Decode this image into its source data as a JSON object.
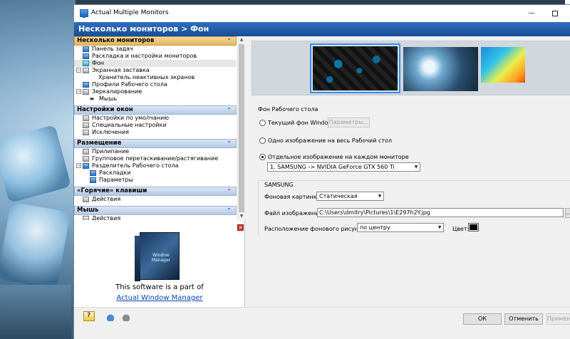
{
  "window": {
    "title": "Actual Multiple Monitors",
    "min_glyph": "—",
    "header": "Несколько мониторов > Фон"
  },
  "nav": {
    "sections": [
      {
        "title": "Несколько мониторов",
        "items": [
          {
            "label": "Панель задач",
            "icon": "taskbar-icon"
          },
          {
            "label": "Раскладка и настройки мониторов",
            "icon": "monitor-layout-icon"
          },
          {
            "label": "Фон",
            "icon": "wallpaper-icon",
            "selected": true
          },
          {
            "label": "Экранная заставка",
            "icon": "screensaver-icon",
            "expander": "−"
          },
          {
            "label": "Хранитель неактивных экранов",
            "icon": "",
            "indent": true
          },
          {
            "label": "Профили Рабочего стола",
            "icon": "desktop-profiles-icon"
          },
          {
            "label": "Зеркалирование",
            "icon": "mirroring-icon",
            "expander": "−"
          },
          {
            "label": "Мышь",
            "icon": "mouse-icon",
            "indent": true
          }
        ]
      },
      {
        "title": "Настройки окон",
        "items": [
          {
            "label": "Настройки по умолчанию",
            "icon": "window-default-icon"
          },
          {
            "label": "Специальные настройки",
            "icon": "window-special-icon"
          },
          {
            "label": "Исключения",
            "icon": "exclusions-icon"
          }
        ]
      },
      {
        "title": "Размещение",
        "items": [
          {
            "label": "Прилипание",
            "icon": "snapping-icon"
          },
          {
            "label": "Групповое перетаскивание/растягивание",
            "icon": "group-drag-icon"
          },
          {
            "label": "Разделитель Рабочего стола",
            "icon": "desktop-divider-icon",
            "expander": "−"
          },
          {
            "label": "Раскладки",
            "icon": "layouts-icon",
            "indent": true
          },
          {
            "label": "Параметры",
            "icon": "parameters-icon",
            "indent": true
          }
        ]
      },
      {
        "title": "«Горячие» клавиши",
        "items": [
          {
            "label": "Действия",
            "icon": "hotkey-actions-icon"
          }
        ]
      },
      {
        "title": "Мышь",
        "items": [
          {
            "label": "Действия",
            "icon": "mouse-actions-icon"
          }
        ]
      }
    ],
    "collapse_glyph": "≈"
  },
  "promo": {
    "box_title": "Window Manager",
    "text": "This software is a part of",
    "link": "Actual Window Manager"
  },
  "background": {
    "group_title": "Фон Рабочего стола",
    "options": [
      {
        "label": "Текущий фон Windows",
        "checked": false
      },
      {
        "label": "Одно изображение на весь Рабочий стол",
        "checked": false
      },
      {
        "label": "Отдельное изображение на каждом мониторе",
        "checked": true
      }
    ],
    "params_button": "Параметры...",
    "monitor_select": "1. SAMSUNG -> NVIDIA GeForce GTX 560 Ti",
    "monitor_group": "SAMSUNG",
    "wallpaper_label": "Фоновая картинка",
    "wallpaper_value": "Статическая",
    "file_label": "Файл изображения:",
    "file_value": "C:\\Users\\dmitry\\Pictures\\1\\E297h2Y.jpg",
    "browse_button": "...",
    "position_label": "Расположение фонового рисунка:",
    "position_value": "по центру",
    "color_label": "Цвет:",
    "color_value": "#000000"
  },
  "footer": {
    "ok": "ОК",
    "cancel": "Отменить",
    "apply": "Примени"
  }
}
